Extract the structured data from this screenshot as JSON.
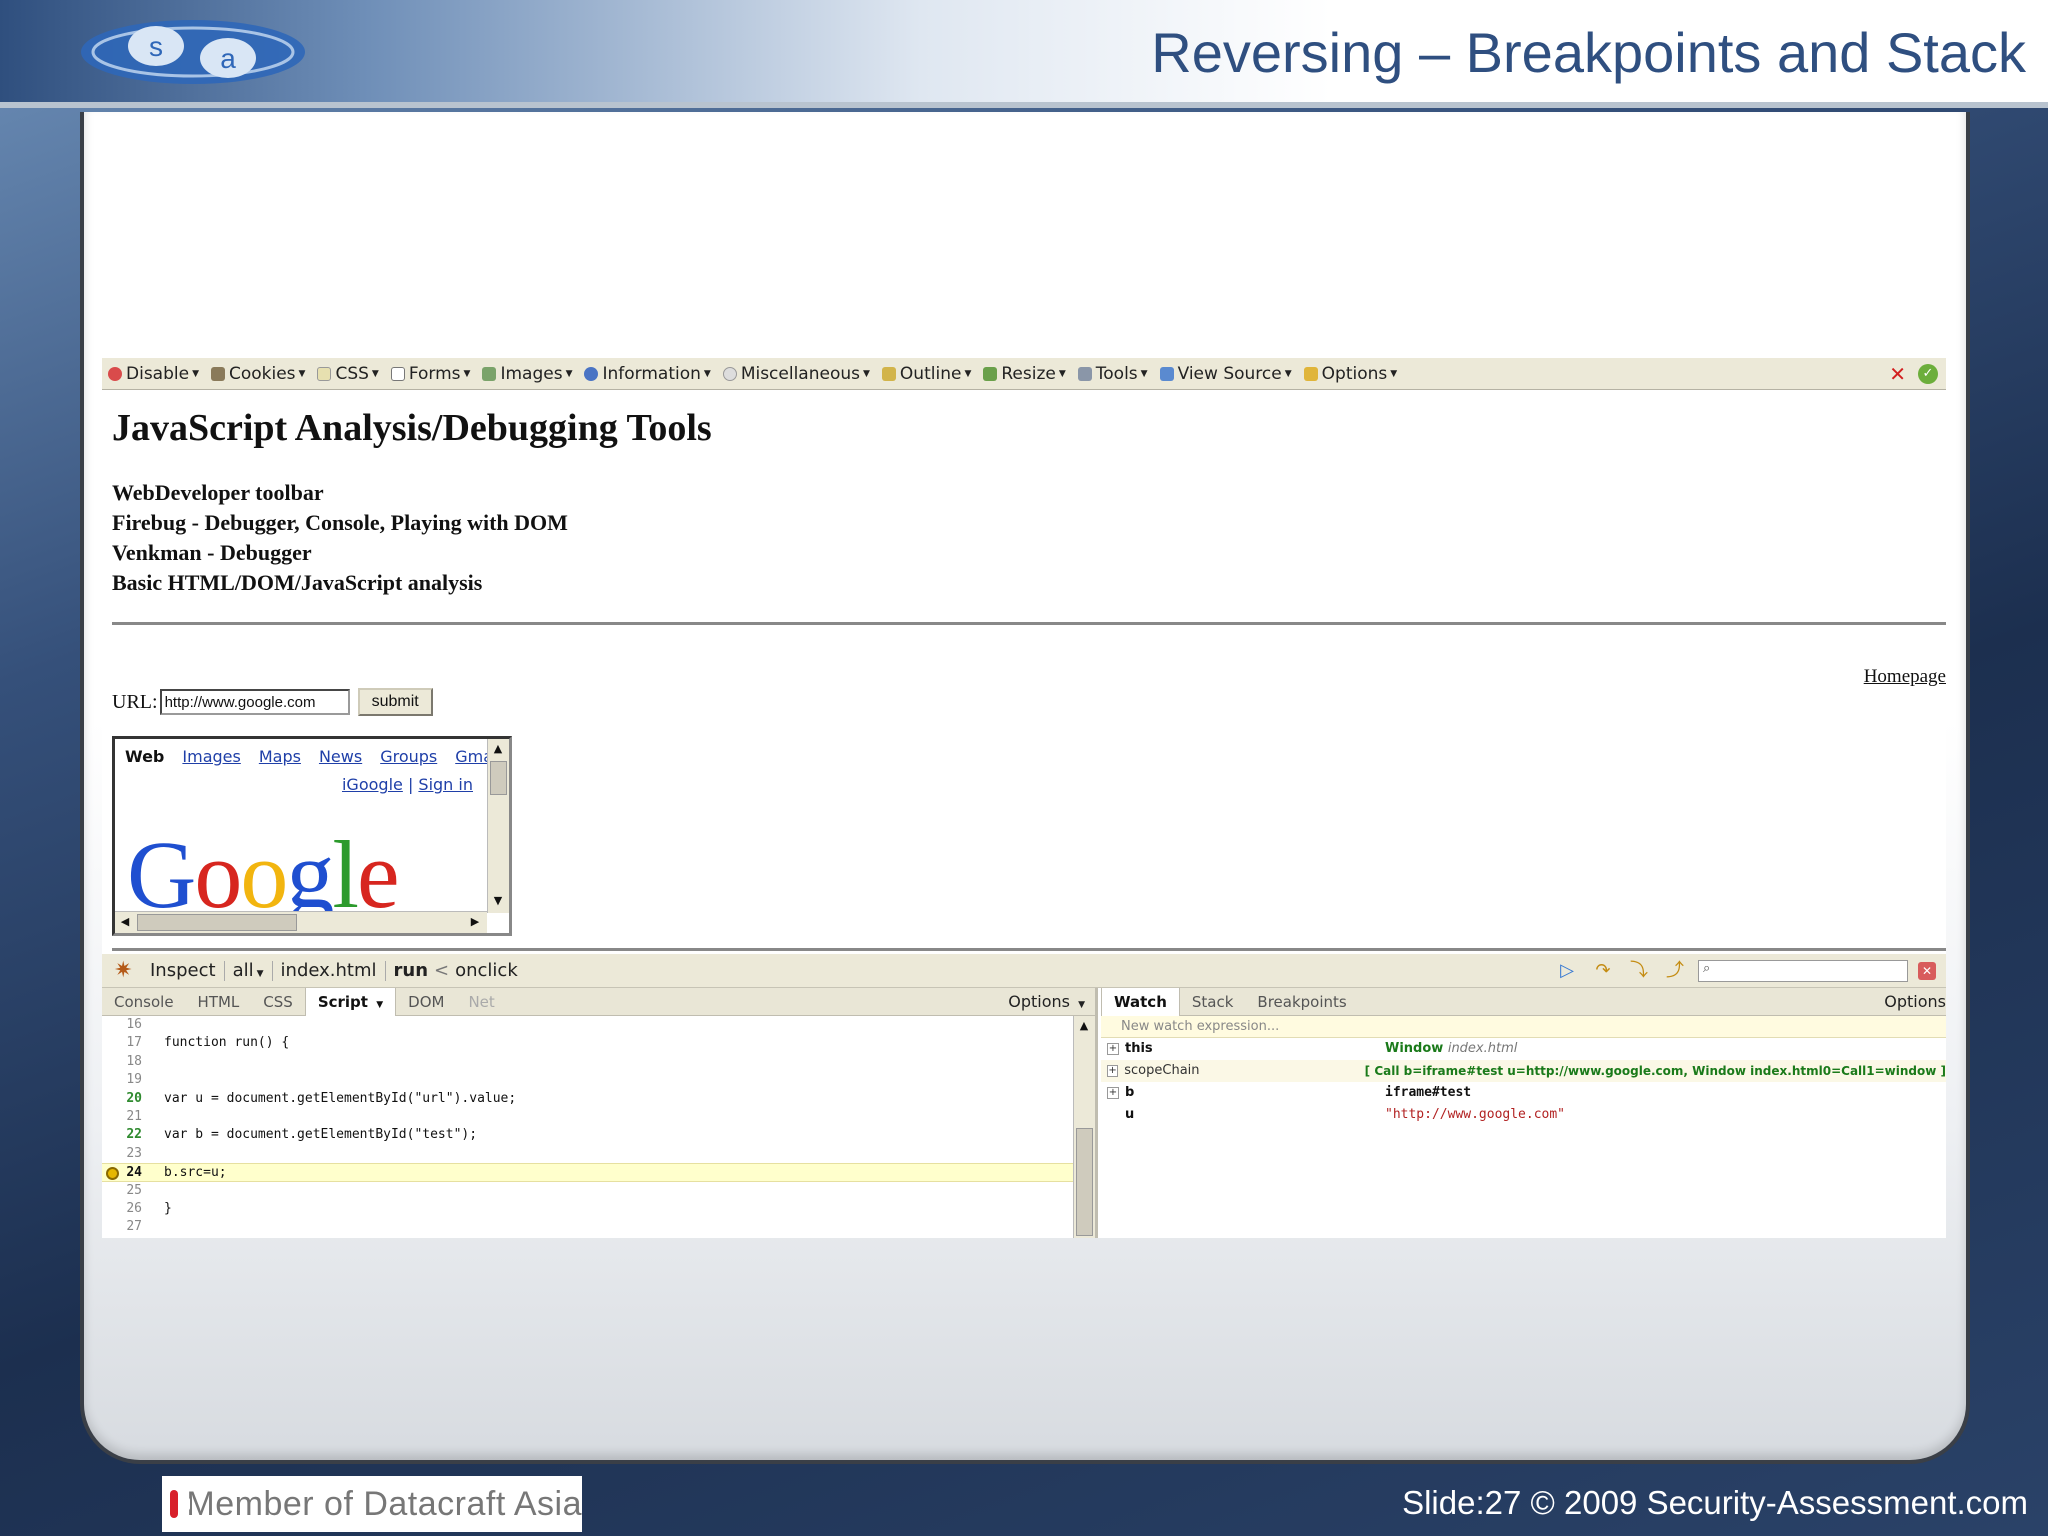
{
  "slide": {
    "title": "Reversing – Breakpoints and Stack",
    "logo_letters": [
      "s",
      "a"
    ],
    "footer_badge": "Member of Datacraft Asia",
    "footer_text": "Slide:27 © 2009 Security-Assessment.com"
  },
  "webdev_toolbar": {
    "items": [
      "Disable",
      "Cookies",
      "CSS",
      "Forms",
      "Images",
      "Information",
      "Miscellaneous",
      "Outline",
      "Resize",
      "Tools",
      "View Source",
      "Options"
    ]
  },
  "page": {
    "heading": "JavaScript Analysis/Debugging Tools",
    "lines": [
      "WebDeveloper toolbar",
      "Firebug - Debugger, Console, Playing with DOM",
      "Venkman - Debugger",
      "Basic HTML/DOM/JavaScript analysis"
    ],
    "homepage_link": "Homepage",
    "url_label": "URL:",
    "url_value": "http://www.google.com",
    "submit_label": "submit"
  },
  "iframe": {
    "nav": [
      "Web",
      "Images",
      "Maps",
      "News",
      "Groups",
      "Gmail"
    ],
    "links": [
      "iGoogle",
      "Sign in"
    ],
    "logo_text": "Google",
    "logo_colors": [
      "#1f4fd0",
      "#d7261f",
      "#f2b50f",
      "#1f4fd0",
      "#2c9a2c",
      "#d7261f"
    ]
  },
  "firebug": {
    "top": {
      "inspect": "Inspect",
      "all": "all",
      "file": "index.html",
      "stack": "run",
      "stack_sep": "<",
      "stack_caller": "onclick"
    },
    "left_tabs": [
      "Console",
      "HTML",
      "CSS",
      "Script",
      "DOM",
      "Net"
    ],
    "left_options": "Options",
    "code_lines": [
      {
        "n": "16",
        "text": ""
      },
      {
        "n": "17",
        "text": "function run() {"
      },
      {
        "n": "18",
        "text": ""
      },
      {
        "n": "19",
        "text": ""
      },
      {
        "n": "20",
        "text": "var u = document.getElementById(\"url\").value;"
      },
      {
        "n": "21",
        "text": ""
      },
      {
        "n": "22",
        "text": "var b = document.getElementById(\"test\");"
      },
      {
        "n": "23",
        "text": ""
      },
      {
        "n": "24",
        "text": "b.src=u;"
      },
      {
        "n": "25",
        "text": ""
      },
      {
        "n": "26",
        "text": "}"
      },
      {
        "n": "27",
        "text": ""
      }
    ],
    "watch_tabs": [
      "Watch",
      "Stack",
      "Breakpoints"
    ],
    "watch_options": "Options",
    "new_watch": "New watch expression...",
    "watch_rows": [
      {
        "name": "this",
        "value": "Window",
        "value_note": "index.html"
      },
      {
        "name": "scopeChain",
        "value": "[ Call b=iframe#test u=http://www.google.com,  Window index.html0=Call1=window ]"
      },
      {
        "name": "b",
        "value": "iframe#test"
      },
      {
        "name": "u",
        "value": "\"http://www.google.com\""
      }
    ]
  },
  "colors": {
    "title": "#2f4f80",
    "google_blue": "#1f4fd0",
    "breakpoint_highlight": "#ffffcc"
  }
}
